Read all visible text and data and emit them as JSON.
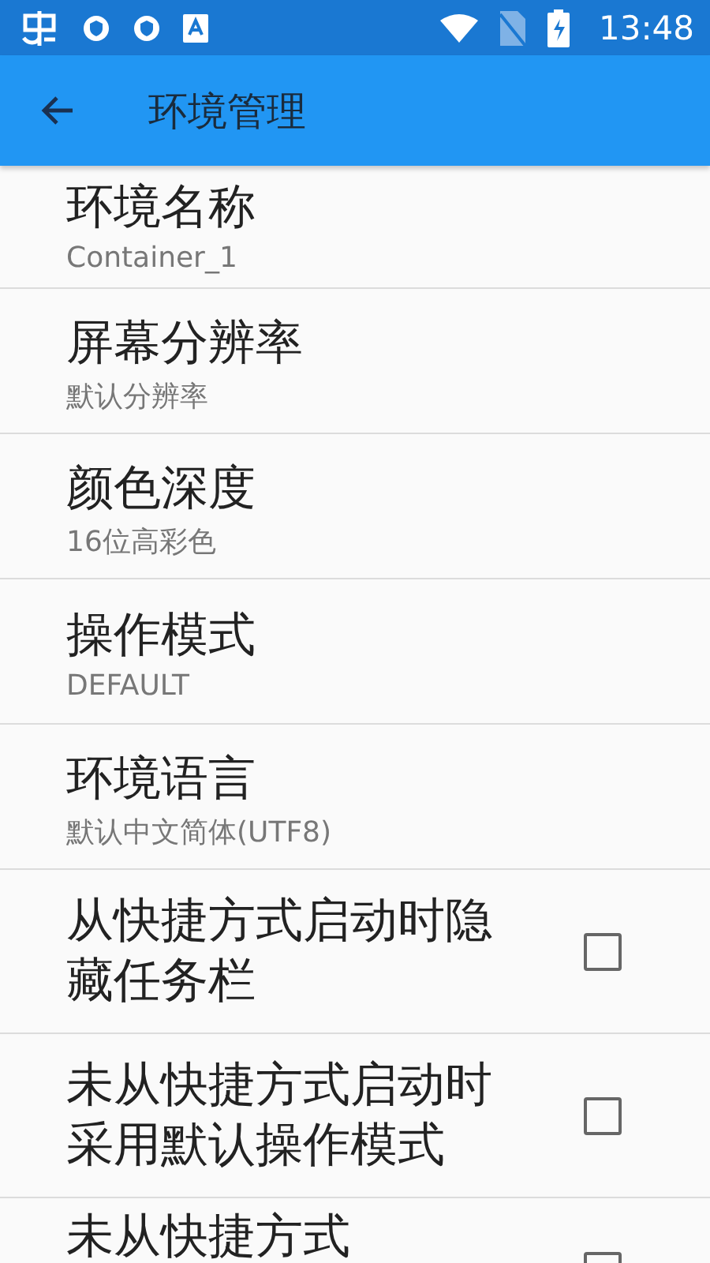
{
  "status_bar": {
    "time": "13:48"
  },
  "toolbar": {
    "title": "环境管理"
  },
  "settings": [
    {
      "kind": "value",
      "title": "环境名称",
      "summary": "Container_1"
    },
    {
      "kind": "value",
      "title": "屏幕分辨率",
      "summary": "默认分辨率"
    },
    {
      "kind": "value",
      "title": "颜色深度",
      "summary": "16位高彩色"
    },
    {
      "kind": "value",
      "title": "操作模式",
      "summary": "DEFAULT"
    },
    {
      "kind": "value",
      "title": "环境语言",
      "summary": "默认中文简体(UTF8)"
    },
    {
      "kind": "checkbox",
      "title": "从快捷方式启动时隐藏任务栏",
      "checked": false
    },
    {
      "kind": "checkbox",
      "title": "未从快捷方式启动时采用默认操作模式",
      "checked": false
    },
    {
      "kind": "checkbox",
      "title": "未从快捷方式",
      "checked": false
    }
  ]
}
